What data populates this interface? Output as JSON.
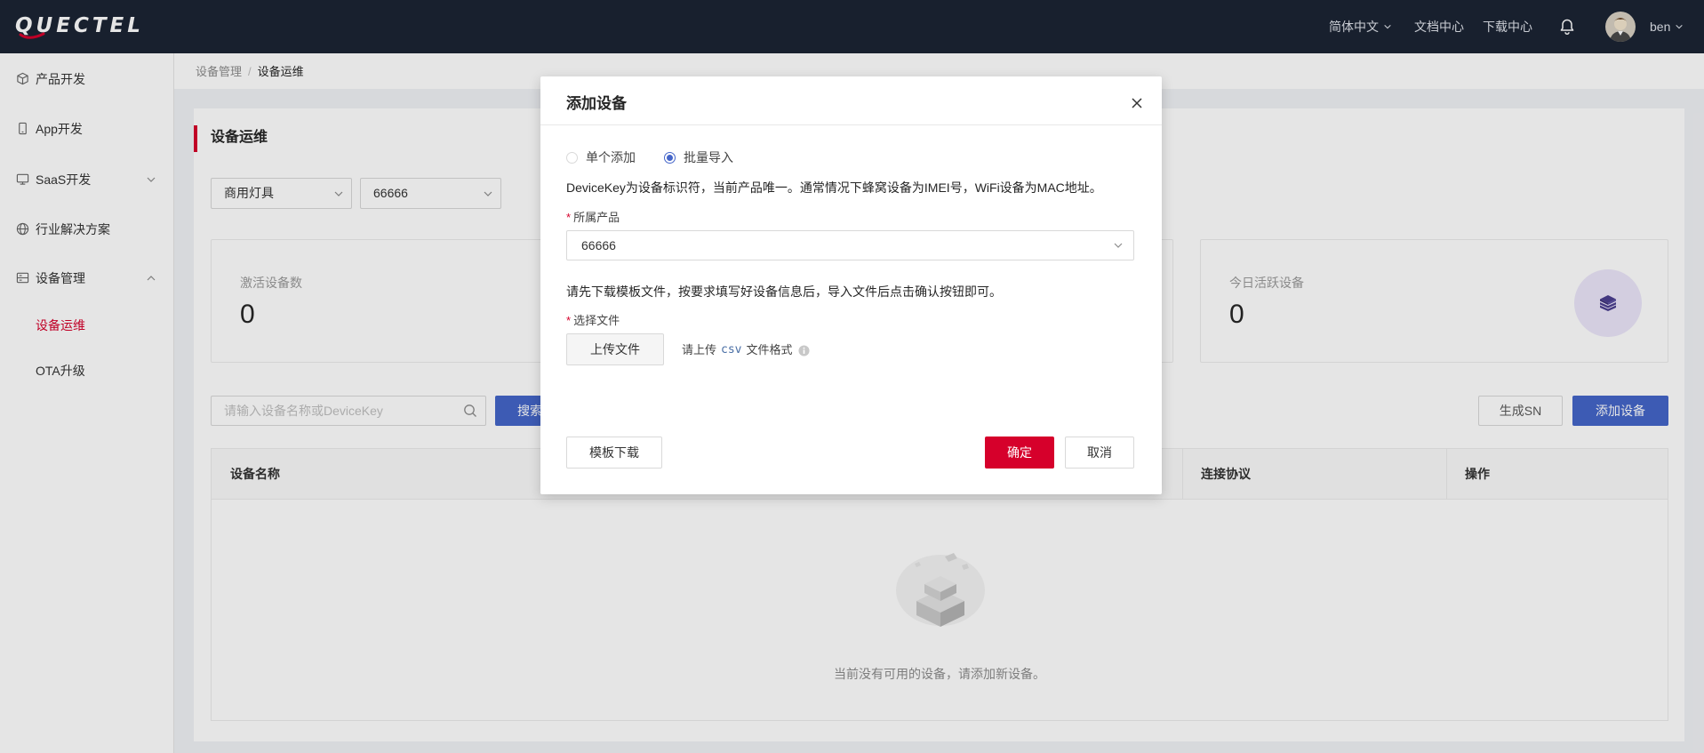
{
  "theme": {
    "red": "#d6002b",
    "blue": "#4566c9",
    "header_bg": "#1b2434"
  },
  "header": {
    "logo_text": "QUECTEL",
    "language": "简体中文",
    "docs": "文档中心",
    "downloads": "下载中心",
    "username": "ben"
  },
  "sidebar": {
    "items": [
      {
        "label": "产品开发",
        "icon": "cube-icon"
      },
      {
        "label": "App开发",
        "icon": "phone-icon"
      },
      {
        "label": "SaaS开发",
        "icon": "monitor-icon",
        "expanded": false
      },
      {
        "label": "行业解决方案",
        "icon": "globe-icon"
      },
      {
        "label": "设备管理",
        "icon": "server-icon",
        "expanded": true,
        "children": [
          {
            "label": "设备运维",
            "active": true
          },
          {
            "label": "OTA升级",
            "active": false
          }
        ]
      }
    ]
  },
  "breadcrumb": {
    "parent": "设备管理",
    "separator": "/",
    "current": "设备运维"
  },
  "page": {
    "title": "设备运维",
    "filters": {
      "category": "商用灯具",
      "product": "66666"
    },
    "stats": {
      "activated": {
        "label": "激活设备数",
        "value": "0"
      },
      "today_active": {
        "label": "今日活跃设备",
        "value": "0",
        "icon": "layers-icon"
      }
    },
    "search": {
      "placeholder": "请输入设备名称或DeviceKey",
      "button": "搜索"
    },
    "actions": {
      "generate_sn": "生成SN",
      "add_device": "添加设备"
    },
    "table": {
      "columns": [
        "设备名称",
        "连接协议",
        "操作"
      ],
      "rows": [],
      "empty_text": "当前没有可用的设备，请添加新设备。"
    }
  },
  "modal": {
    "title": "添加设备",
    "mode_options": [
      {
        "label": "单个添加",
        "checked": false
      },
      {
        "label": "批量导入",
        "checked": true
      }
    ],
    "description": "DeviceKey为设备标识符，当前产品唯一。通常情况下蜂窝设备为IMEI号，WiFi设备为MAC地址。",
    "required_mark": "*",
    "product_label": "所属产品",
    "product_value": "66666",
    "instruction": "请先下载模板文件，按要求填写好设备信息后，导入文件后点击确认按钮即可。",
    "file_label": "选择文件",
    "upload_button": "上传文件",
    "file_hint": {
      "prefix": "请上传",
      "format": "csv",
      "suffix": "文件格式"
    },
    "template_button": "模板下载",
    "confirm_button": "确定",
    "cancel_button": "取消"
  }
}
